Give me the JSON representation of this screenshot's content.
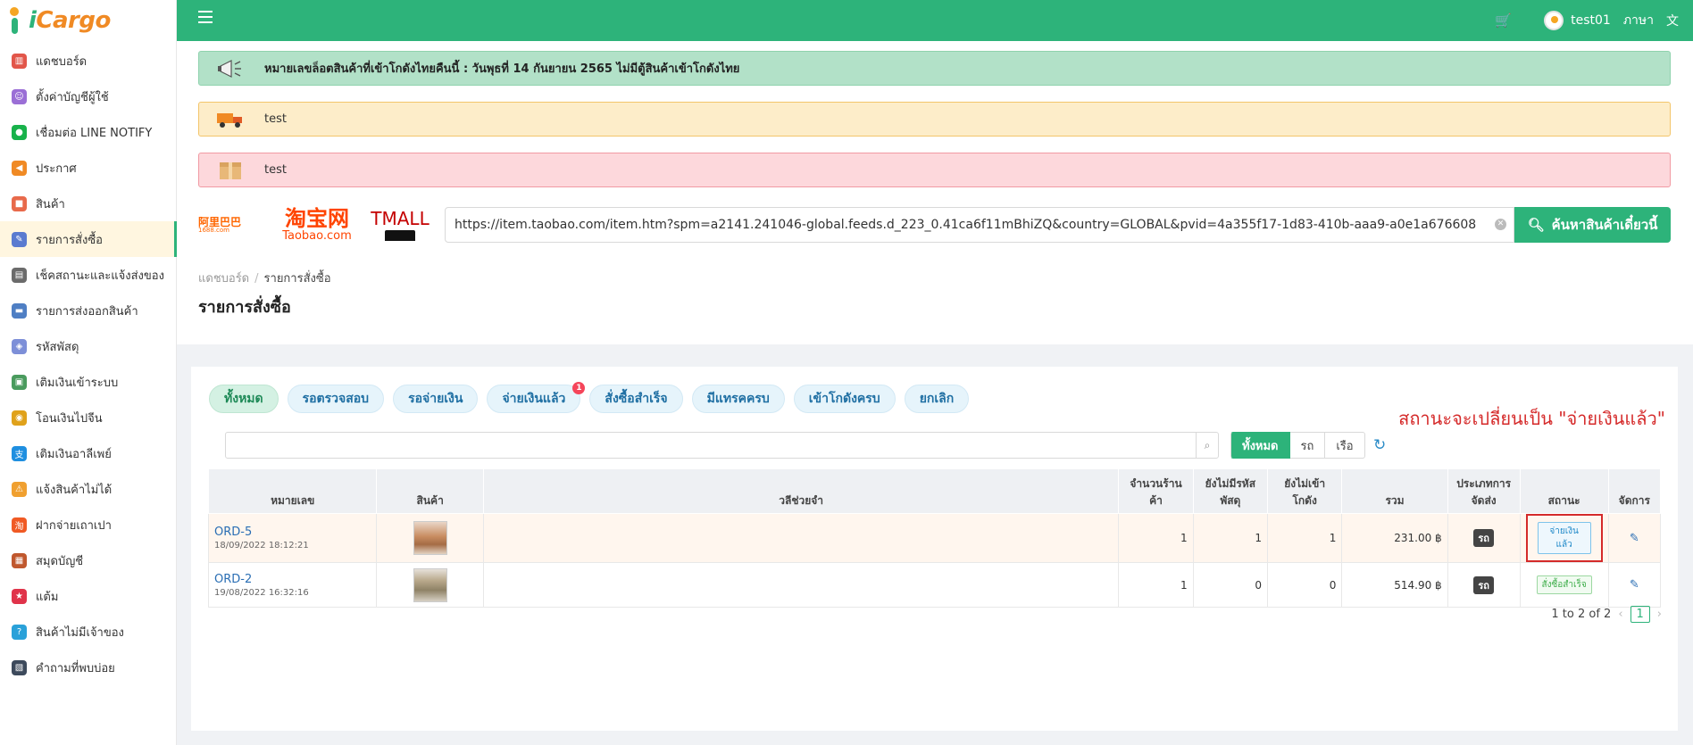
{
  "app": {
    "logo_i": "i",
    "logo_rest": "Cargo",
    "brand_color": "#2db37a"
  },
  "sidebar": {
    "items": [
      {
        "label": "แดชบอร์ด",
        "icon": "chart-icon",
        "color": "#e2564a"
      },
      {
        "label": "ตั้งค่าบัญชีผู้ใช้",
        "icon": "user-settings-icon",
        "color": "#9b6fd6"
      },
      {
        "label": "เชื่อมต่อ LINE NOTIFY",
        "icon": "line-icon",
        "color": "#18b24b"
      },
      {
        "label": "ประกาศ",
        "icon": "megaphone-icon",
        "color": "#f08a24"
      },
      {
        "label": "สินค้า",
        "icon": "box-icon",
        "color": "#e86a4b"
      },
      {
        "label": "รายการสั่งซื้อ",
        "icon": "order-icon",
        "color": "#5a7bd0"
      },
      {
        "label": "เช็คสถานะและแจ้งส่งของ",
        "icon": "status-icon",
        "color": "#6b6b6b"
      },
      {
        "label": "รายการส่งออกสินค้า",
        "icon": "truck-icon",
        "color": "#4f7fc4"
      },
      {
        "label": "รหัสพัสดุ",
        "icon": "parcel-icon",
        "color": "#7d8fd8"
      },
      {
        "label": "เติมเงินเข้าระบบ",
        "icon": "wallet-icon",
        "color": "#4a9b5e"
      },
      {
        "label": "โอนเงินไปจีน",
        "icon": "coin-icon",
        "color": "#e0a21b"
      },
      {
        "label": "เติมเงินอาลีเพย์",
        "icon": "alipay-icon",
        "color": "#1f8fe0"
      },
      {
        "label": "แจ้งสินค้าไม่ได้",
        "icon": "warning-icon",
        "color": "#f0a030"
      },
      {
        "label": "ฝากจ่ายเถาเปา",
        "icon": "taobao-icon",
        "color": "#f05a24"
      },
      {
        "label": "สมุดบัญชี",
        "icon": "book-icon",
        "color": "#c0582e"
      },
      {
        "label": "แต้ม",
        "icon": "star-icon",
        "color": "#e0334a"
      },
      {
        "label": "สินค้าไม่มีเจ้าของ",
        "icon": "question-icon",
        "color": "#2aa1d9"
      },
      {
        "label": "คำถามที่พบบ่อย",
        "icon": "faq-icon",
        "color": "#3d4a5c"
      }
    ],
    "active_index": 5
  },
  "topbar": {
    "username": "test01",
    "language_label": "ภาษา"
  },
  "alerts": {
    "green_text": "หมายเลขล็อตสินค้าที่เข้าโกดังไทยคืนนี้ : วันพุธที่ 14 กันยายน 2565 ไม่มีตู้สินค้าเข้าโกดังไทย",
    "yellow_text": "test",
    "red_text": "test"
  },
  "product_search": {
    "logo_1688": "阿里巴巴",
    "logo_1688_sub": "1688.com",
    "logo_taobao": "淘宝网",
    "logo_taobao_sub": "Taobao.com",
    "logo_tmall": "TMALL",
    "url_value": "https://item.taobao.com/item.htm?spm=a2141.241046-global.feeds.d_223_0.41ca6f11mBhiZQ&country=GLOBAL&pvid=4a355f17-1d83-410b-aaa9-a0e1a676608",
    "button_label": "ค้นหาสินค้าเดี๋ยวนี้"
  },
  "breadcrumb": {
    "home": "แดชบอร์ด",
    "current": "รายการสั่งซื้อ"
  },
  "page_title": "รายการสั่งซื้อ",
  "tabs": [
    {
      "label": "ทั้งหมด",
      "active": true
    },
    {
      "label": "รอตรวจสอบ"
    },
    {
      "label": "รอจ่ายเงิน"
    },
    {
      "label": "จ่ายเงินแล้ว",
      "badge": "1"
    },
    {
      "label": "สั่งซื้อสำเร็จ"
    },
    {
      "label": "มีแทรคครบ"
    },
    {
      "label": "เข้าโกดังครบ"
    },
    {
      "label": "ยกเลิก"
    }
  ],
  "annotation_note": "สถานะจะเปลี่ยนเป็น \"จ่ายเงินแล้ว\"",
  "transport_filter": {
    "all": "ทั้งหมด",
    "truck": "รถ",
    "ship": "เรือ"
  },
  "table": {
    "headers": {
      "order_no": "หมายเลข",
      "product": "สินค้า",
      "memo": "วลีช่วยจำ",
      "shop_count": "จำนวนร้านค้า",
      "no_tracking": "ยังไม่มีรหัสพัสดุ",
      "not_in_warehouse": "ยังไม่เข้าโกดัง",
      "total": "รวม",
      "shipping_type": "ประเภทการจัดส่ง",
      "status": "สถานะ",
      "actions": "จัดการ"
    },
    "rows": [
      {
        "order_no": "ORD-5",
        "date": "18/09/2022 18:12:21",
        "shop_count": "1",
        "no_tracking": "1",
        "not_in_warehouse": "1",
        "total": "231.00 ฿",
        "shipping": "รถ",
        "status": "จ่ายเงินแล้ว",
        "status_kind": "paid"
      },
      {
        "order_no": "ORD-2",
        "date": "19/08/2022 16:32:16",
        "shop_count": "1",
        "no_tracking": "0",
        "not_in_warehouse": "0",
        "total": "514.90 ฿",
        "shipping": "รถ",
        "status": "สั่งซื้อสำเร็จ",
        "status_kind": "done"
      }
    ]
  },
  "pagination": {
    "summary": "1 to 2 of 2",
    "current_page": "1"
  }
}
